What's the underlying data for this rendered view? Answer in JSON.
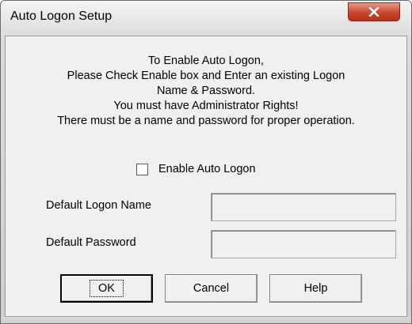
{
  "window": {
    "title": "Auto Logon Setup"
  },
  "info_lines": [
    "To Enable Auto Logon,",
    "Please Check Enable box and Enter an existing Logon",
    "Name & Password.",
    "You must have Administrator Rights!",
    "There must be a name and password for proper operation."
  ],
  "enable_checkbox": {
    "label": "Enable Auto Logon",
    "checked": false
  },
  "fields": {
    "logon_name_label": "Default Logon Name",
    "logon_name_value": "",
    "password_label": "Default Password",
    "password_value": ""
  },
  "buttons": {
    "ok": "OK",
    "cancel": "Cancel",
    "help": "Help"
  },
  "icons": {
    "close": "close-icon"
  },
  "colors": {
    "close_button": "#c9452e",
    "dialog_background": "#f0f0f0"
  }
}
